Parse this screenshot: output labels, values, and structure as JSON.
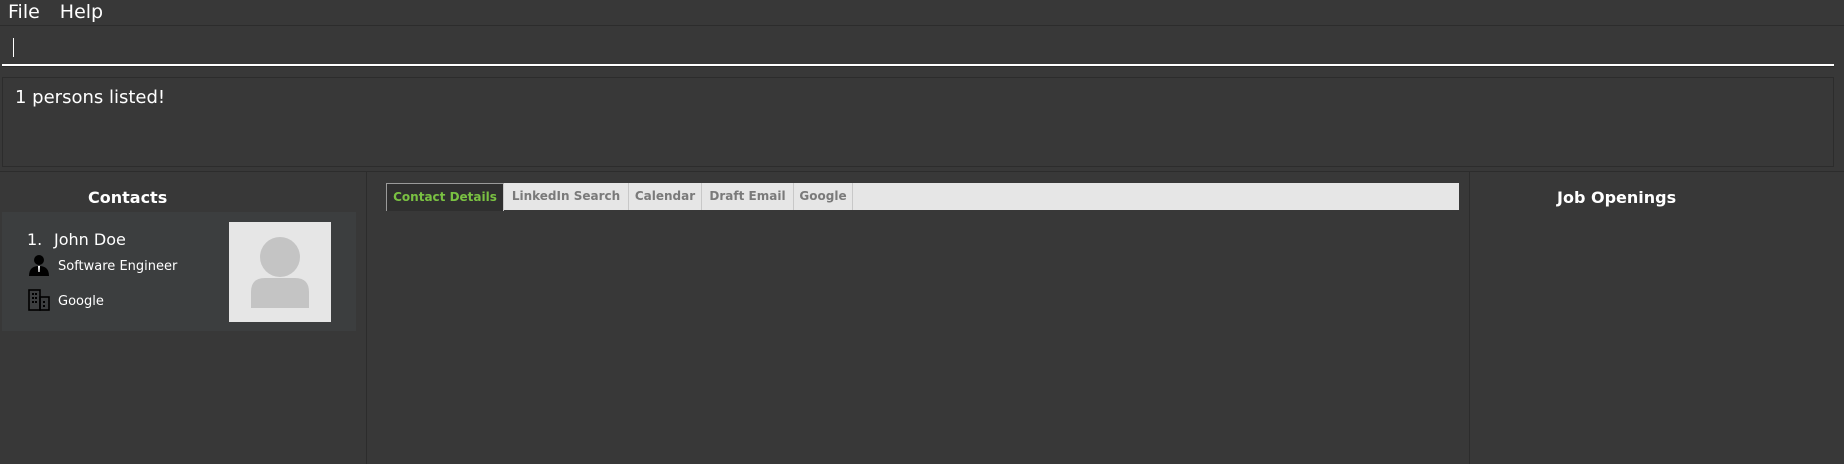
{
  "menu": {
    "items": [
      "File",
      "Help"
    ]
  },
  "command_box": {
    "value": ""
  },
  "result": {
    "text": "1 persons listed!"
  },
  "contacts": {
    "title": "Contacts",
    "persons": [
      {
        "index": "1.",
        "name": "John Doe",
        "role": "Software Engineer",
        "company": "Google"
      }
    ]
  },
  "tabs": [
    "Contact Details",
    "LinkedIn Search",
    "Calendar",
    "Draft Email",
    "Google"
  ],
  "active_tab": "Contact Details",
  "job_openings": {
    "title": "Job Openings"
  },
  "colors": {
    "background": "#383838",
    "card": "#3c3e3f",
    "accent_tab": "#7ac142",
    "tab_bar": "#e6e6e6"
  },
  "icons": {
    "role": "person-silhouette-icon",
    "company": "building-icon",
    "avatar": "avatar-placeholder-icon"
  }
}
